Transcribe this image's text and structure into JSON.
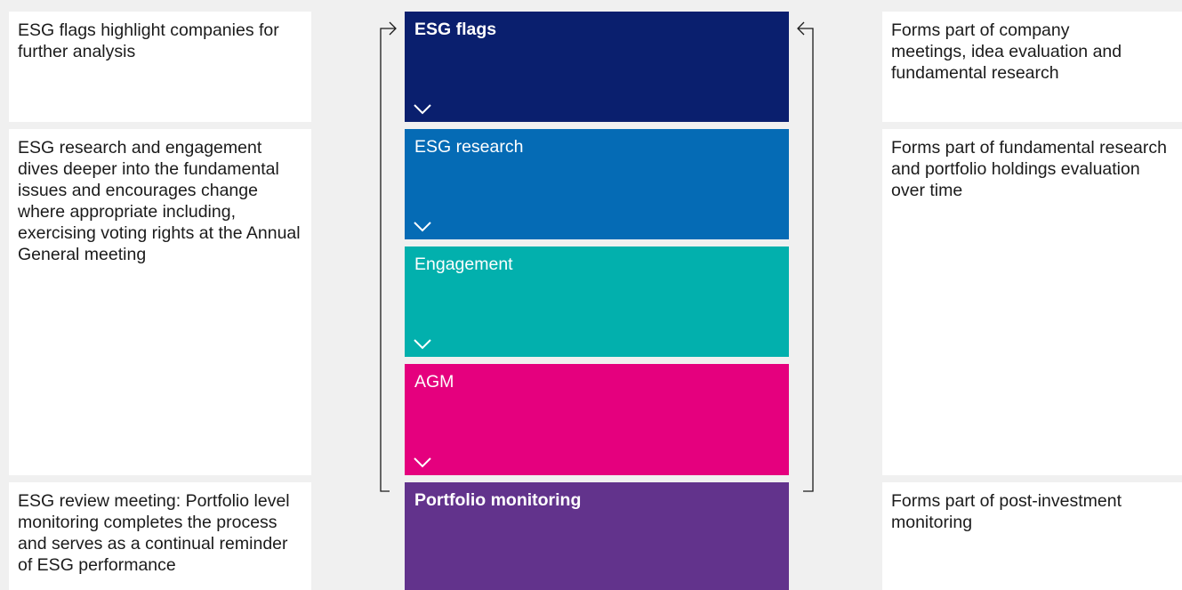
{
  "colors": {
    "esg_flags": "#0a1f6e",
    "esg_research": "#056bb5",
    "engagement": "#02b0ad",
    "agm": "#e5007e",
    "portfolio_monitoring": "#62338c"
  },
  "left_notes": [
    {
      "text": "ESG flags highlight companies for further analysis"
    },
    {
      "text": "ESG research and engagement dives deeper into the fundamental issues and encourages change where appropriate including, exercising voting rights at the Annual General meeting"
    },
    {
      "text": "ESG review meeting: Portfolio level monitoring completes the process and serves as a continual reminder of ESG performance"
    }
  ],
  "stages": [
    {
      "label": "ESG flags",
      "icon": "chevron-down-icon"
    },
    {
      "label": "ESG research",
      "icon": "chevron-down-icon"
    },
    {
      "label": "Engagement",
      "icon": "chevron-down-icon"
    },
    {
      "label": "AGM",
      "icon": "chevron-down-icon"
    },
    {
      "label": "Portfolio monitoring"
    }
  ],
  "right_notes": [
    {
      "text": "Forms part of company meetings, idea evaluation and fundamental research"
    },
    {
      "text": "Forms part of fundamental research and portfolio holdings evaluation over time"
    },
    {
      "text": "Forms part of post-investment monitoring"
    }
  ]
}
